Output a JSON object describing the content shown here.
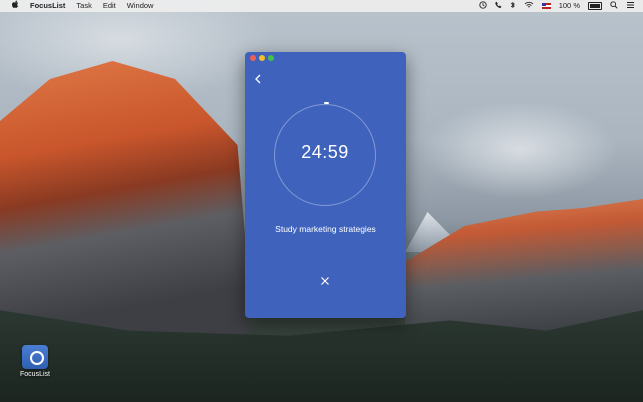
{
  "menubar": {
    "apple_icon": "apple-icon",
    "app_name": "FocusList",
    "menus": [
      "Task",
      "Edit",
      "Window"
    ],
    "battery_percent": "100 %"
  },
  "desktop": {
    "icon_label": "FocusList"
  },
  "window": {
    "timer": "24:59",
    "task_name": "Study marketing strategies",
    "back_glyph": "‹",
    "close_glyph": "✕"
  },
  "colors": {
    "window_bg": "#3f63bd",
    "close_red": "#ee5f58",
    "minimize_yellow": "#f6be2f",
    "zoom_green": "#3ec346"
  }
}
